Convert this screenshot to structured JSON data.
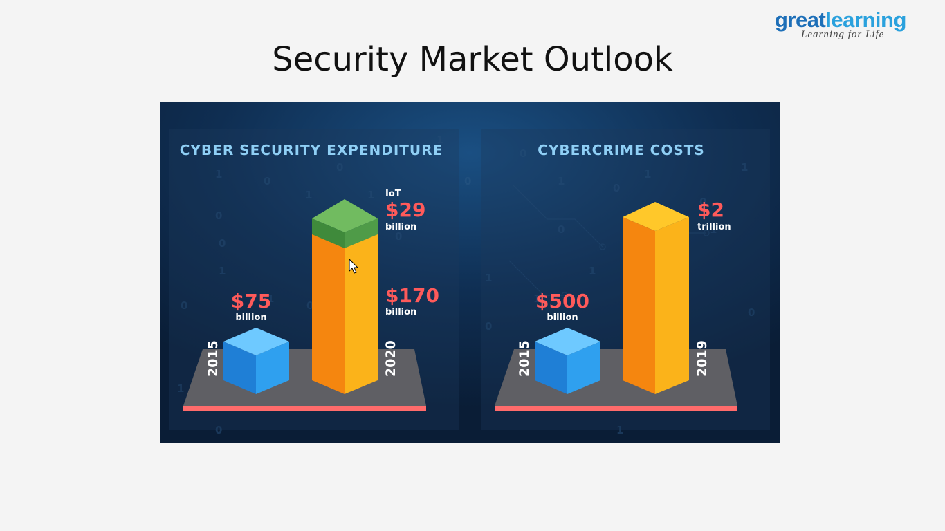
{
  "logo": {
    "part1": "great",
    "part2": "learning",
    "tagline": "Learning for Life"
  },
  "slide": {
    "title": "Security Market Outlook"
  },
  "panels": {
    "expenditure": {
      "title": "CYBER SECURITY EXPENDITURE",
      "bar1": {
        "year": "2015",
        "value": "$75",
        "unit": "billion"
      },
      "bar2": {
        "year": "2020",
        "value": "$170",
        "unit": "billion"
      },
      "iot": {
        "label": "IoT",
        "value": "$29",
        "unit": "billion"
      }
    },
    "cybercrime": {
      "title": "CYBERCRIME COSTS",
      "bar1": {
        "year": "2015",
        "value": "$500",
        "unit": "billion"
      },
      "bar2": {
        "year": "2019",
        "value": "$2",
        "unit": "trillion"
      }
    }
  },
  "colors": {
    "background": "#0d2440",
    "accent_value": "#ff5a5a",
    "orange": "#f7a313",
    "blue": "#2a8fe6",
    "green": "#4f9b48",
    "baseline": "#ff6b6b",
    "panel_title": "#8fcff5"
  }
}
